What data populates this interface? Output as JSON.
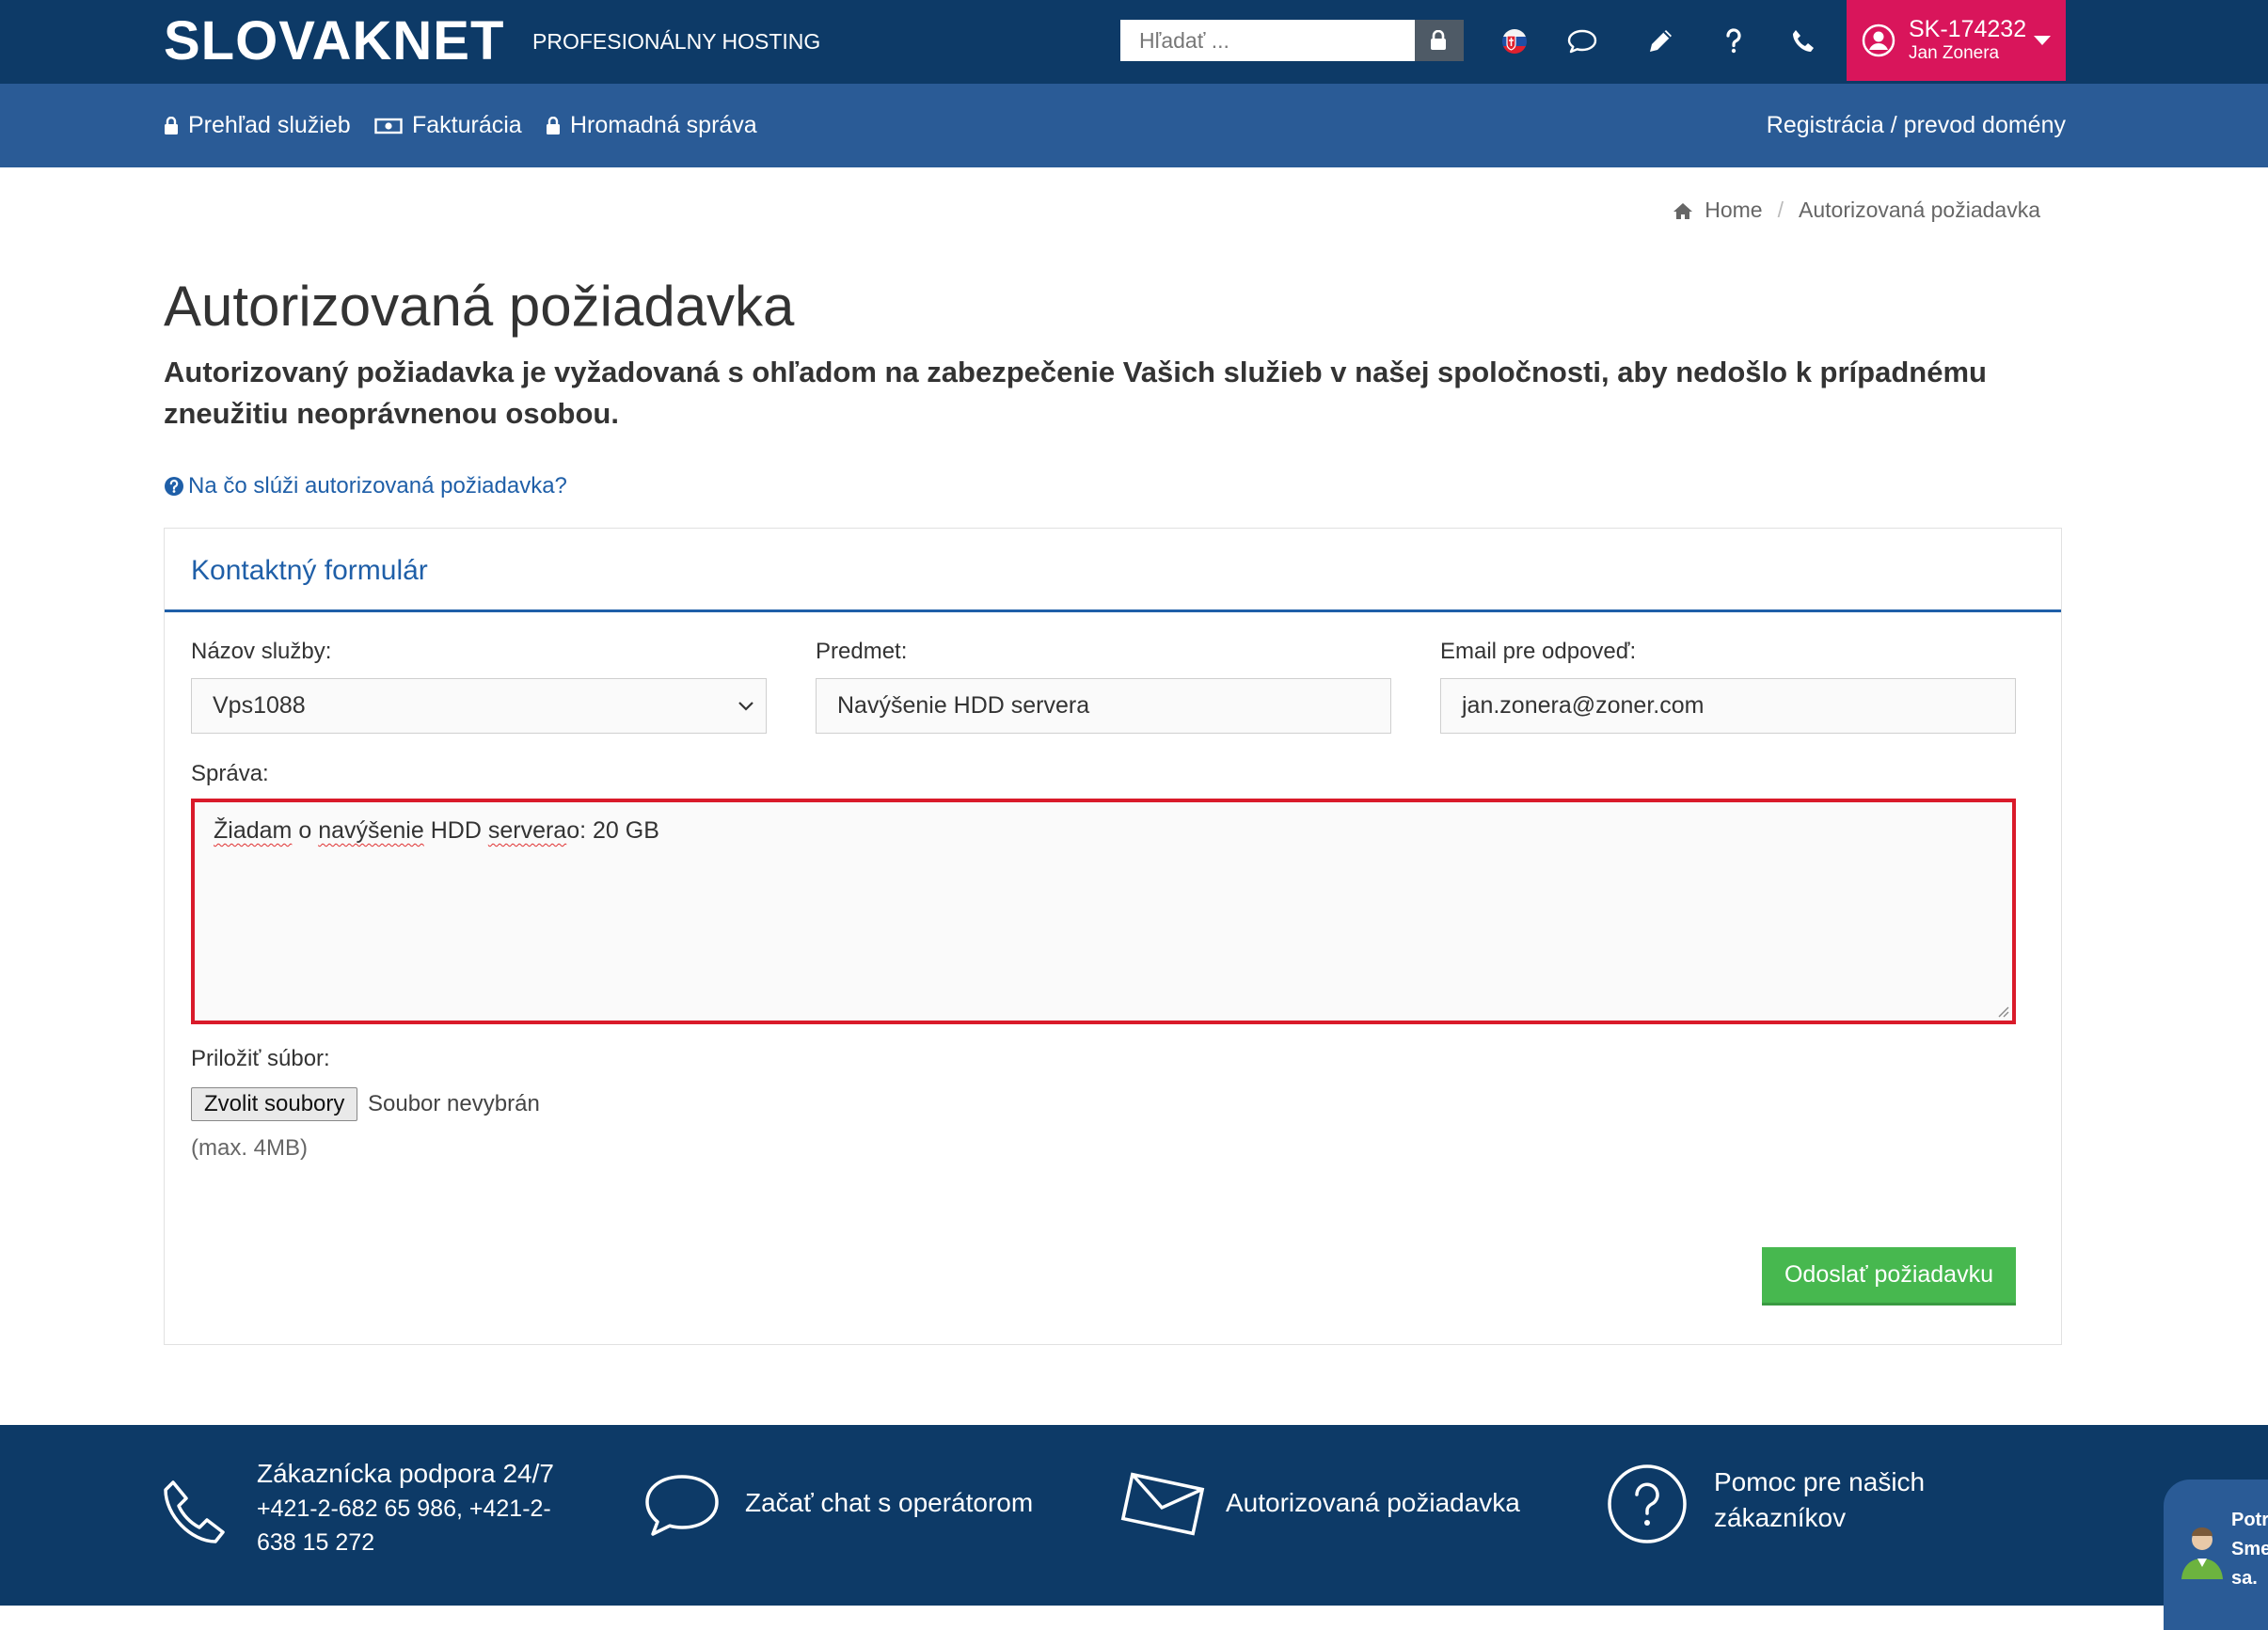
{
  "header": {
    "logo": "SLOVAKNET",
    "tagline": "PROFESIONÁLNY HOSTING",
    "search_placeholder": "Hľadať ...",
    "account_id": "SK-174232",
    "account_name": "Jan Zonera"
  },
  "nav": {
    "services": "Prehľad služieb",
    "billing": "Fakturácia",
    "bulk": "Hromadná správa",
    "domain_link": "Registrácia / prevod domény"
  },
  "breadcrumb": {
    "home": "Home",
    "sep": "/",
    "current": "Autorizovaná požiadavka"
  },
  "page": {
    "title": "Autorizovaná požiadavka",
    "lead": "Autorizovaný požiadavka je vyžadovaná s ohľadom na zabezpečenie Vašich služieb v našej spoločnosti, aby nedošlo k prípadnému zneužitiu neoprávnenou osobou.",
    "help_link": "Na čo slúži autorizovaná požiadavka?"
  },
  "form": {
    "panel_title": "Kontaktný formulár",
    "service_label": "Názov služby:",
    "service_value": "Vps1088",
    "subject_label": "Predmet:",
    "subject_value": "Navýšenie HDD servera",
    "email_label": "Email pre odpoveď:",
    "email_value": "jan.zonera@zoner.com",
    "message_label": "Správa:",
    "message_words": [
      "Žiadam",
      "o",
      "navýšenie",
      "HDD",
      "servera",
      "o: 20 GB"
    ],
    "attach_label": "Priložiť súbor:",
    "file_button": "Zvolit soubory",
    "file_status": "Soubor nevybrán",
    "file_hint": "(max. 4MB)",
    "submit": "Odoslať požiadavku"
  },
  "footer": {
    "support_title": "Zákaznícka podpora 24/7",
    "support_phone_1": "+421-2-682 65 986, +421-2-",
    "support_phone_2": "638 15 272",
    "chat": "Začať chat s operátorom",
    "authorized": "Autorizovaná požiadavka",
    "help_1": "Pomoc pre našich",
    "help_2": "zákazníkov",
    "widget_text": "Potr\nSme\nsa."
  },
  "colors": {
    "topbar": "#0d3a67",
    "subnav": "#2a5b96",
    "account": "#d9155b",
    "accent": "#1f5fa8",
    "highlight_border": "#d91a2a",
    "submit": "#47b84f"
  }
}
